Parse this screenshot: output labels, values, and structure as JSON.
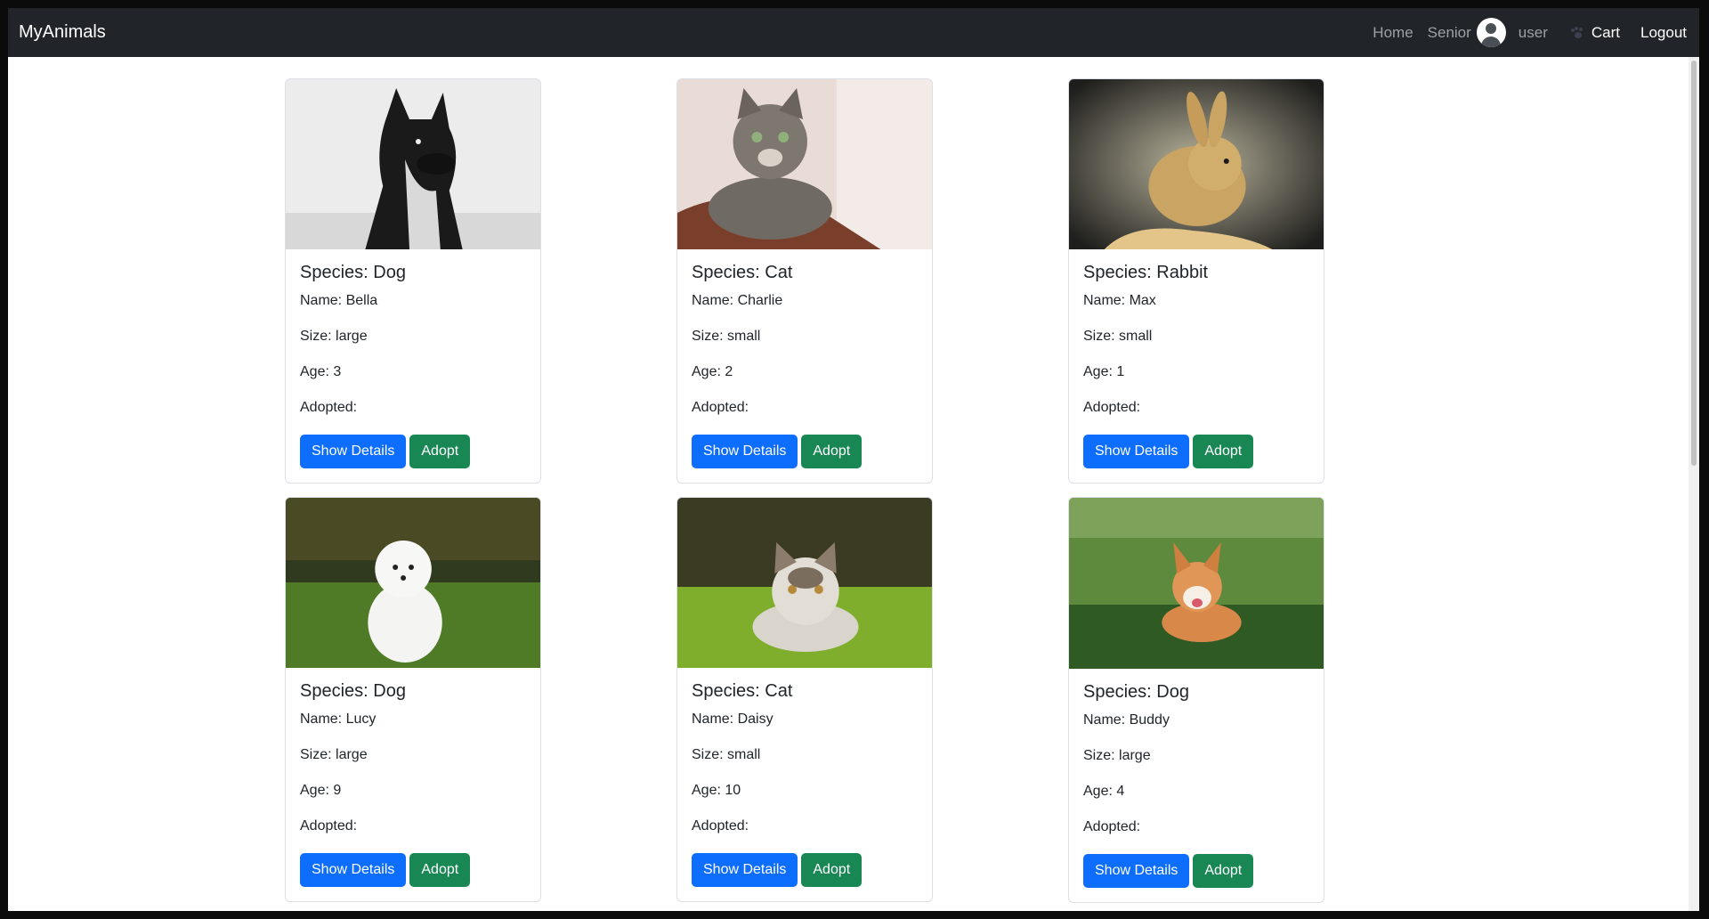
{
  "app": {
    "brand": "MyAnimals"
  },
  "nav": {
    "home": "Home",
    "senior": "Senior",
    "user": "user",
    "cart": "Cart",
    "logout": "Logout",
    "avatar_icon": "user-avatar-icon",
    "cart_icon": "paw-icon"
  },
  "colors": {
    "navbar": "#212529",
    "primary_button": "#0d6efd",
    "success_button": "#198754"
  },
  "animals": [
    {
      "species": "Species: Dog",
      "name": "Name: Bella",
      "size": "Size: large",
      "age": "Age: 3",
      "adopted": "Adopted:",
      "details_btn": "Show Details",
      "adopt_btn": "Adopt"
    },
    {
      "species": "Species: Cat",
      "name": "Name: Charlie",
      "size": "Size: small",
      "age": "Age: 2",
      "adopted": "Adopted:",
      "details_btn": "Show Details",
      "adopt_btn": "Adopt"
    },
    {
      "species": "Species: Rabbit",
      "name": "Name: Max",
      "size": "Size: small",
      "age": "Age: 1",
      "adopted": "Adopted:",
      "details_btn": "Show Details",
      "adopt_btn": "Adopt"
    },
    {
      "species": "Species: Dog",
      "name": "Name: Lucy",
      "size": "Size: large",
      "age": "Age: 9",
      "adopted": "Adopted:",
      "details_btn": "Show Details",
      "adopt_btn": "Adopt"
    },
    {
      "species": "Species: Cat",
      "name": "Name: Daisy",
      "size": "Size: small",
      "age": "Age: 10",
      "adopted": "Adopted:",
      "details_btn": "Show Details",
      "adopt_btn": "Adopt"
    },
    {
      "species": "Species: Dog",
      "name": "Name: Buddy",
      "size": "Size: large",
      "age": "Age: 4",
      "adopted": "Adopted:",
      "details_btn": "Show Details",
      "adopt_btn": "Adopt"
    }
  ]
}
